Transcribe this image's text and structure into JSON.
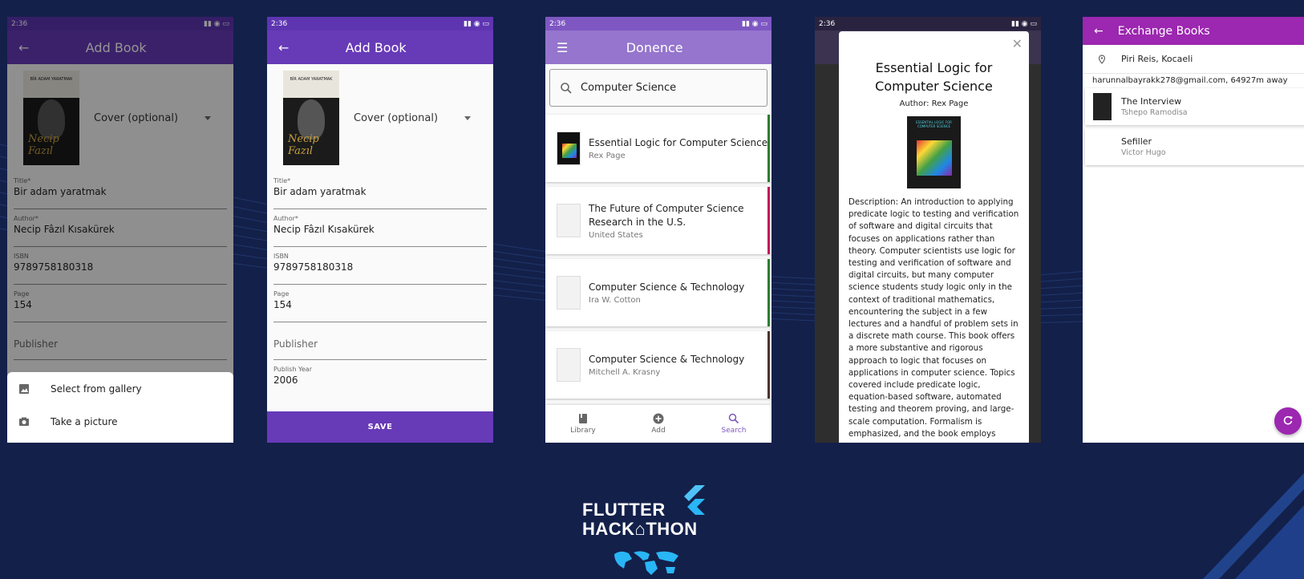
{
  "colors": {
    "background": "#13204a",
    "purple_dark": "#673ab7",
    "purple_light": "#9575cd",
    "magenta": "#9c27b0",
    "green_bar": "#2e7d32",
    "pink_bar": "#c2185b",
    "brown_bar": "#4e342e",
    "navy_bar": "#3f51b5",
    "olive_bar": "#9e9d24"
  },
  "status_time": "2:36",
  "screen1": {
    "title": "Add Book",
    "cover_dropdown": "Cover (optional)",
    "cover_art_title": "BİR ADAM YARATMAK",
    "fields": [
      {
        "label": "Title*",
        "value": "Bir adam yaratmak"
      },
      {
        "label": "Author*",
        "value": "Necip Fâzıl Kısakürek"
      },
      {
        "label": "ISBN",
        "value": "9789758180318"
      },
      {
        "label": "Page",
        "value": "154"
      }
    ],
    "publisher_placeholder": "Publisher",
    "sheet": {
      "gallery": "Select from gallery",
      "camera": "Take a picture"
    }
  },
  "screen2": {
    "title": "Add Book",
    "cover_dropdown": "Cover (optional)",
    "cover_art_title": "BİR ADAM YARATMAK",
    "fields": [
      {
        "label": "Title*",
        "value": "Bir adam yaratmak"
      },
      {
        "label": "Author*",
        "value": "Necip Fâzıl Kısakürek"
      },
      {
        "label": "ISBN",
        "value": "9789758180318"
      },
      {
        "label": "Page",
        "value": "154"
      }
    ],
    "publisher_placeholder": "Publisher",
    "year": {
      "label": "Publish Year",
      "value": "2006"
    },
    "save": "SAVE"
  },
  "screen3": {
    "title": "Donence",
    "search_value": "Computer Science",
    "results": [
      {
        "title": "Essential Logic for Computer Science",
        "author": "Rex Page",
        "bar": "#2e7d32"
      },
      {
        "title": "The Future of Computer Science Research in the U.S.",
        "author": "United States",
        "bar": "#c2185b"
      },
      {
        "title": "Computer Science & Technology",
        "author": "Ira W. Cotton",
        "bar": "#2e7d32"
      },
      {
        "title": "Computer Science & Technology",
        "author": "Mitchell A. Krasny",
        "bar": "#4e342e"
      }
    ],
    "nav": {
      "library": "Library",
      "add": "Add",
      "search": "Search"
    }
  },
  "screen4": {
    "title": "Essential Logic for Computer Science",
    "author": "Author: Rex Page",
    "cover_text": "ESSENTIAL LOGIC FOR COMPUTER SCIENCE",
    "description": "Description: An introduction to applying predicate logic to testing and verification of software and digital circuits that focuses on applications rather than theory. Computer scientists use logic for testing and verification of software and digital circuits, but many computer science students study logic only in the context of traditional mathematics, encountering the subject in a few lectures and a handful of problem sets in a discrete math course. This book offers a more substantive and rigorous approach to logic that focuses on applications in computer science. Topics covered include predicate logic, equation-based software, automated testing and theorem proving, and large-scale computation. Formalism is emphasized, and the book employs"
  },
  "screen5": {
    "title": "Exchange Books",
    "location": "Piri Reis, Kocaeli",
    "user": "harunnalbayrakk278@gmail.com, 64927m away",
    "books": [
      {
        "title": "The Interview",
        "author": "Tshepo Ramodisa",
        "bar": "#3f51b5"
      },
      {
        "title": "Sefiller",
        "author": "Victor Hugo",
        "bar": "#9e9d24"
      }
    ]
  },
  "logo": {
    "line1": "FLUTTER",
    "line2": "HACK⌂THON"
  }
}
